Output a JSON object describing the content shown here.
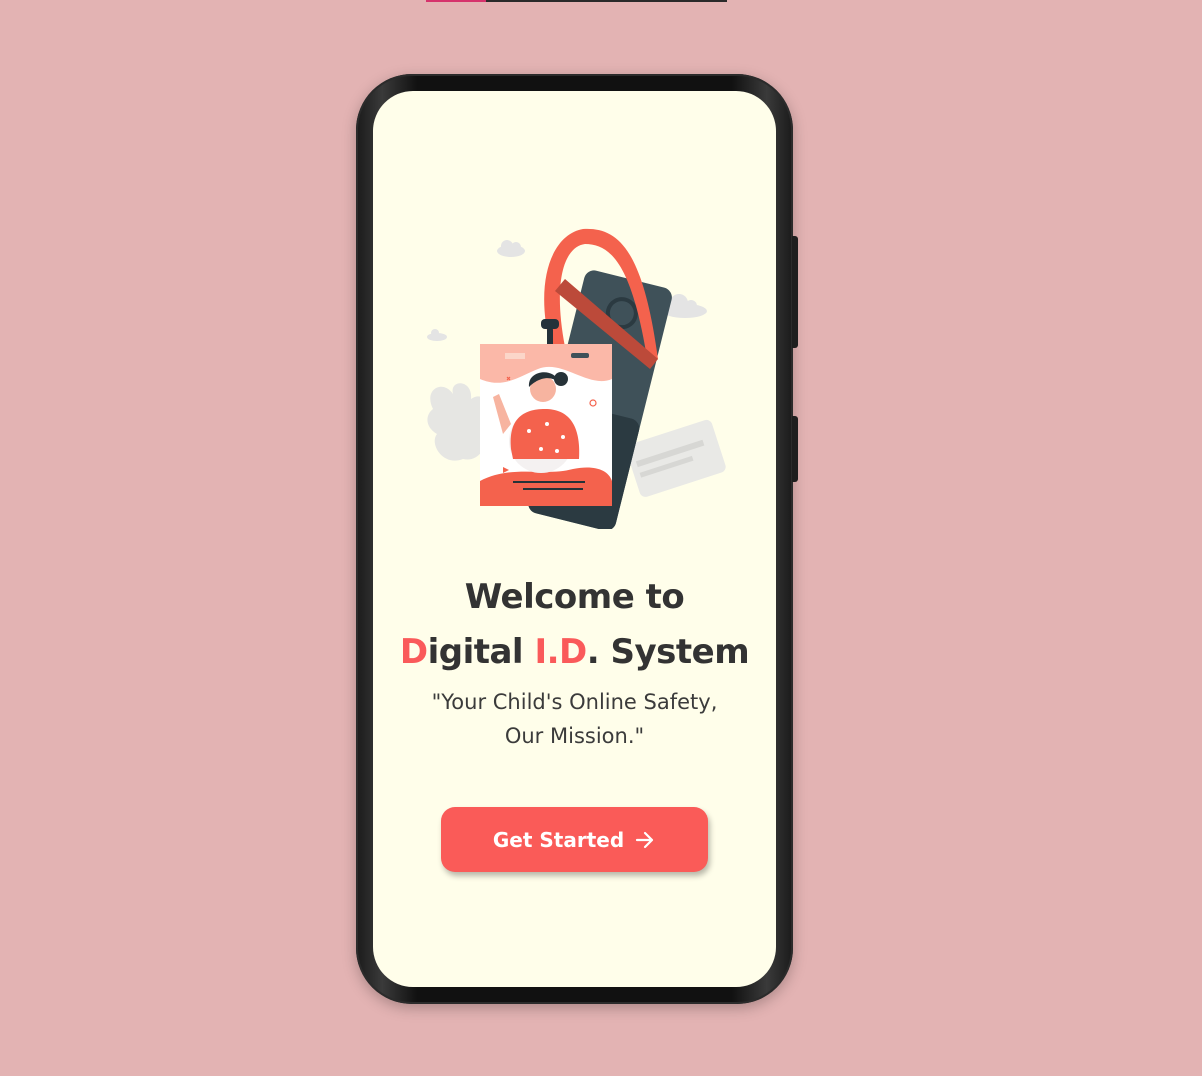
{
  "welcome": {
    "line1": "Welcome to",
    "line2": {
      "d_letter": "D",
      "after_d": "igital ",
      "id_letters": "I.D",
      "suffix": ". System"
    },
    "tagline_line1": "\"Your Child's Online Safety,",
    "tagline_line2": "Our Mission.\""
  },
  "cta": {
    "label": "Get Started",
    "icon": "arrow-right-icon"
  },
  "illustration": {
    "icon": "id-card-illustration"
  },
  "colors": {
    "page_background": "#e3b3b3",
    "screen_background": "#fffeea",
    "accent": "#fa5a5a",
    "text": "#333333"
  }
}
